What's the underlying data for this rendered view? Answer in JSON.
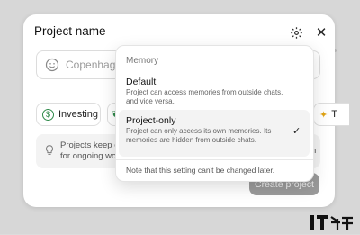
{
  "dialog": {
    "title": "Project name",
    "name_placeholder": "Copenhagen",
    "chips": [
      {
        "label": "Investing",
        "icon": "dollar-circle-icon"
      },
      {
        "label": "",
        "icon": "leaf-icon"
      },
      {
        "label": "T",
        "icon": "star-icon"
      }
    ],
    "info_line1": "Projects keep ch",
    "info_line2": "for ongoing work",
    "info_right": "n",
    "create_button": "Create project"
  },
  "memory_menu": {
    "header": "Memory",
    "options": [
      {
        "label": "Default",
        "description": "Project can access memories from outside chats, and vice versa.",
        "selected": false
      },
      {
        "label": "Project-only",
        "description": "Project can only access its own memories. Its memories are hidden from outside chats.",
        "selected": true
      }
    ],
    "check_glyph": "✓",
    "note": "Note that this setting can't be changed later."
  },
  "watermark": "IT之家",
  "colors": {
    "selected_bg": "#f3f3f3",
    "button_disabled": "#9b9b9b",
    "backdrop": "#d7d7d7"
  }
}
